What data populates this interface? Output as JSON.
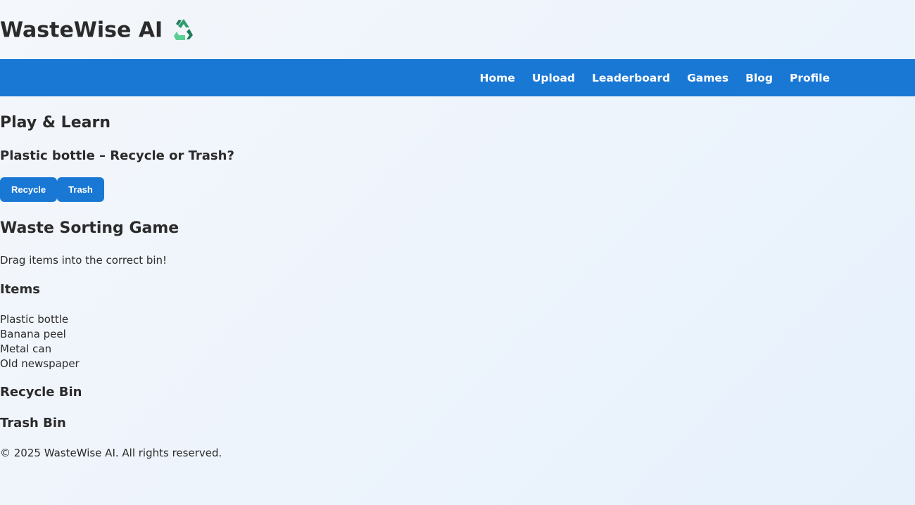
{
  "app": {
    "title": "WasteWise AI",
    "logo_icon": "recycle-icon"
  },
  "nav": {
    "items": [
      {
        "label": "Home"
      },
      {
        "label": "Upload"
      },
      {
        "label": "Leaderboard"
      },
      {
        "label": "Games"
      },
      {
        "label": "Blog"
      },
      {
        "label": "Profile"
      }
    ]
  },
  "quiz": {
    "heading": "Play & Learn",
    "question": "Plastic bottle – Recycle or Trash?",
    "recycle_label": "Recycle",
    "trash_label": "Trash"
  },
  "game": {
    "heading": "Waste Sorting Game",
    "instructions": "Drag items into the correct bin!",
    "items_heading": "Items",
    "items": [
      "Plastic bottle",
      "Banana peel",
      "Metal can",
      "Old newspaper"
    ],
    "recycle_bin_heading": "Recycle Bin",
    "trash_bin_heading": "Trash Bin"
  },
  "footer": {
    "text": "© 2025 WasteWise AI. All rights reserved."
  },
  "colors": {
    "accent": "#1a78d5",
    "text": "#2b2b2b"
  }
}
